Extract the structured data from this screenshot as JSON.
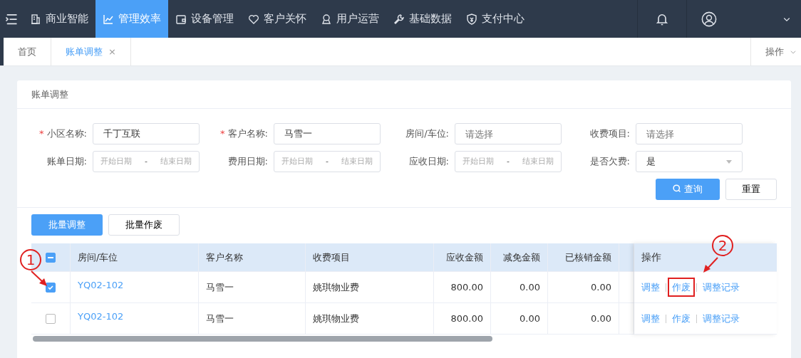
{
  "navbar": {
    "items": [
      {
        "label": "商业智能",
        "selected": false
      },
      {
        "label": "管理效率",
        "selected": true
      },
      {
        "label": "设备管理",
        "selected": false
      },
      {
        "label": "客户关怀",
        "selected": false
      },
      {
        "label": "用户运营",
        "selected": false
      },
      {
        "label": "基础数据",
        "selected": false
      },
      {
        "label": "支付中心",
        "selected": false
      }
    ]
  },
  "page_tabs": {
    "tabs": [
      {
        "label": "首页",
        "selected": false
      },
      {
        "label": "账单调整",
        "selected": true,
        "close": "×"
      }
    ],
    "actions": "操作"
  },
  "card": {
    "title": "账单调整",
    "filters": [
      {
        "required_mark": "*",
        "label": "小区名称:",
        "kind": "text",
        "value": "千丁互联"
      },
      {
        "required_mark": "*",
        "label": "客户名称:",
        "kind": "text",
        "value": "马雪一"
      },
      {
        "label": "房间/车位:",
        "kind": "text",
        "placeholder": "请选择"
      },
      {
        "label": "收费项目:",
        "kind": "text",
        "placeholder": "请选择"
      },
      {
        "label": "账单日期:",
        "kind": "daterange",
        "start": "开始日期",
        "sep": "-",
        "end": "结束日期"
      },
      {
        "label": "费用日期:",
        "kind": "daterange",
        "start": "开始日期",
        "sep": "-",
        "end": "结束日期"
      },
      {
        "label": "应收日期:",
        "kind": "daterange",
        "start": "开始日期",
        "sep": "-",
        "end": "结束日期"
      },
      {
        "label": "是否欠费:",
        "kind": "select",
        "value": "是"
      }
    ],
    "search_button": "查询",
    "reset_button": "重置",
    "batch_buttons": [
      "批量调整",
      "批量作废"
    ],
    "table": {
      "select_all_indeterminate": true,
      "columns": [
        "房间/车位",
        "客户名称",
        "收费项目",
        "应收金额",
        "减免金额",
        "已核销金额"
      ],
      "actions_column": "操作",
      "rows": [
        {
          "selected": true,
          "cells": [
            "YQ02-102",
            "马雪一",
            "姚琪物业费",
            "800.00",
            "0.00",
            "0.00"
          ],
          "actions": [
            "调整",
            "作废",
            "调整记录"
          ]
        },
        {
          "selected": false,
          "cells": [
            "YQ02-102",
            "马雪一",
            "姚琪物业费",
            "800.00",
            "0.00",
            "0.00"
          ],
          "actions": [
            "调整",
            "作废",
            "调整记录"
          ]
        }
      ]
    }
  },
  "annotations": [
    {
      "label": "1"
    },
    {
      "label": "2"
    }
  ]
}
